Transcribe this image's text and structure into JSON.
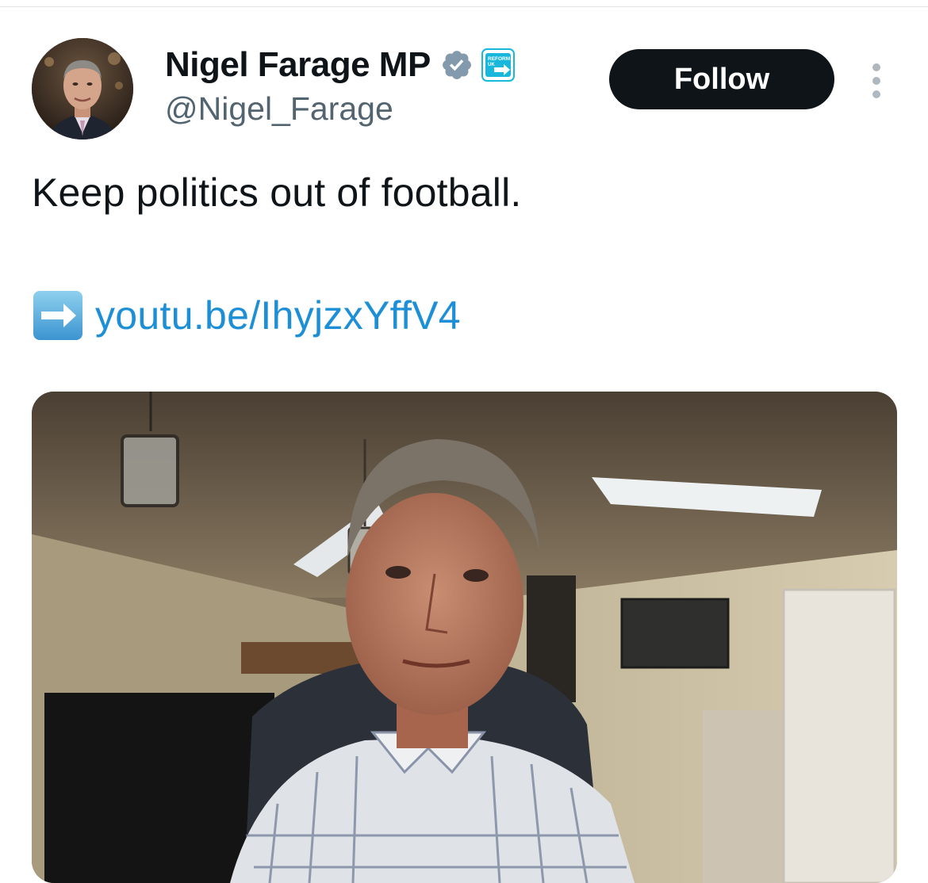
{
  "tweet": {
    "author": {
      "display_name": "Nigel Farage MP",
      "handle": "@Nigel_Farage",
      "verified_icon": "verified-badge-icon",
      "affiliate_badge_text": "REFORM UK"
    },
    "follow_label": "Follow",
    "more_icon": "more-options-icon",
    "text": "Keep politics out of football.",
    "link_emoji": "right-arrow-emoji",
    "link_text": "youtu.be/IhyjzxYffV4",
    "media": {
      "kind": "video-thumbnail"
    }
  },
  "colors": {
    "text_primary": "#0f1419",
    "text_secondary": "#536471",
    "link": "#1d8fd6",
    "follow_bg": "#0f1419",
    "verified": "#829aab",
    "reform_badge": "#19b7dc"
  }
}
